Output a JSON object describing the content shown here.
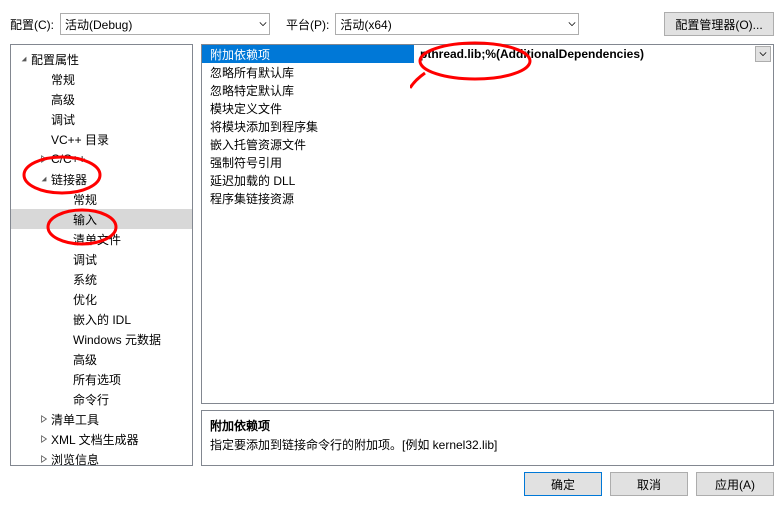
{
  "toolbar": {
    "config_label": "配置(C):",
    "config_value": "活动(Debug)",
    "platform_label": "平台(P):",
    "platform_value": "活动(x64)",
    "config_manager_btn": "配置管理器(O)..."
  },
  "tree": {
    "items": [
      {
        "label": "配置属性",
        "indent": 0,
        "expand": "open"
      },
      {
        "label": "常规",
        "indent": 1
      },
      {
        "label": "高级",
        "indent": 1
      },
      {
        "label": "调试",
        "indent": 1
      },
      {
        "label": "VC++ 目录",
        "indent": 1
      },
      {
        "label": "C/C++",
        "indent": 1,
        "expand": "closed"
      },
      {
        "label": "链接器",
        "indent": 1,
        "expand": "open"
      },
      {
        "label": "常规",
        "indent": 2
      },
      {
        "label": "输入",
        "indent": 2,
        "selected": true
      },
      {
        "label": "清单文件",
        "indent": 2
      },
      {
        "label": "调试",
        "indent": 2
      },
      {
        "label": "系统",
        "indent": 2
      },
      {
        "label": "优化",
        "indent": 2
      },
      {
        "label": "嵌入的 IDL",
        "indent": 2
      },
      {
        "label": "Windows 元数据",
        "indent": 2
      },
      {
        "label": "高级",
        "indent": 2
      },
      {
        "label": "所有选项",
        "indent": 2
      },
      {
        "label": "命令行",
        "indent": 2
      },
      {
        "label": "清单工具",
        "indent": 1,
        "expand": "closed"
      },
      {
        "label": "XML 文档生成器",
        "indent": 1,
        "expand": "closed"
      },
      {
        "label": "浏览信息",
        "indent": 1,
        "expand": "closed"
      }
    ]
  },
  "grid": {
    "rows": [
      {
        "label": "附加依赖项",
        "value": "pthread.lib;%(AdditionalDependencies)",
        "selected": true,
        "hasDropdown": true
      },
      {
        "label": "忽略所有默认库",
        "value": ""
      },
      {
        "label": "忽略特定默认库",
        "value": ""
      },
      {
        "label": "模块定义文件",
        "value": ""
      },
      {
        "label": "将模块添加到程序集",
        "value": ""
      },
      {
        "label": "嵌入托管资源文件",
        "value": ""
      },
      {
        "label": "强制符号引用",
        "value": ""
      },
      {
        "label": "延迟加载的 DLL",
        "value": ""
      },
      {
        "label": "程序集链接资源",
        "value": ""
      }
    ]
  },
  "description": {
    "title": "附加依赖项",
    "text": "指定要添加到链接命令行的附加项。[例如 kernel32.lib]"
  },
  "buttons": {
    "ok": "确定",
    "cancel": "取消",
    "apply": "应用(A)"
  }
}
